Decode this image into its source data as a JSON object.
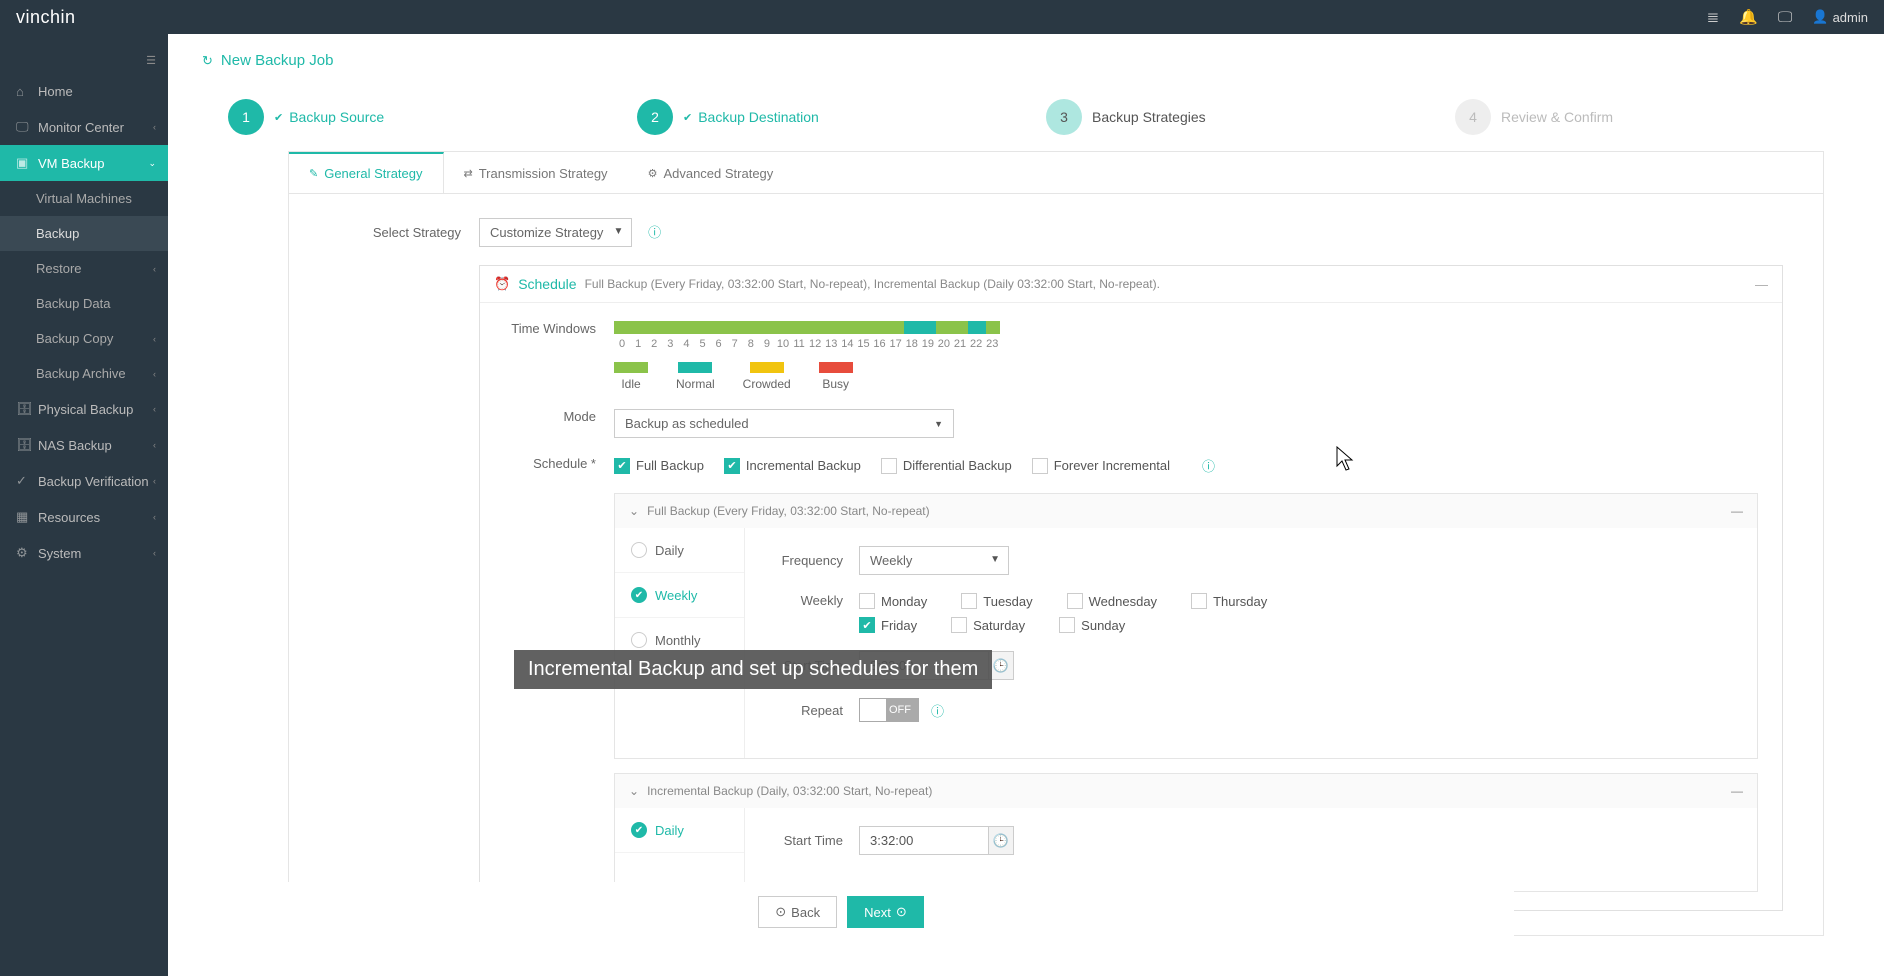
{
  "header": {
    "brand_prefix": "vin",
    "brand_suffix": "chin",
    "user_label": "admin"
  },
  "sidebar": {
    "items": [
      "Home",
      "Monitor Center",
      "VM Backup",
      "Virtual Machines",
      "Backup",
      "Restore",
      "Backup Data",
      "Backup Copy",
      "Backup Archive",
      "Physical Backup",
      "NAS Backup",
      "Backup Verification",
      "Resources",
      "System"
    ]
  },
  "page": {
    "title": "New Backup Job"
  },
  "stepper": {
    "s1": "Backup Source",
    "s2": "Backup Destination",
    "s3": "Backup Strategies",
    "s4": "Review & Confirm",
    "n1": "1",
    "n2": "2",
    "n3": "3",
    "n4": "4"
  },
  "tabs": {
    "general": "General Strategy",
    "transmission": "Transmission Strategy",
    "advanced": "Advanced Strategy"
  },
  "form": {
    "select_strategy_label": "Select Strategy",
    "select_strategy_value": "Customize Strategy",
    "schedule_title": "Schedule",
    "schedule_desc": "Full Backup (Every Friday, 03:32:00 Start, No-repeat), Incremental Backup (Daily 03:32:00 Start, No-repeat).",
    "time_windows_label": "Time Windows",
    "hours": [
      "0",
      "1",
      "2",
      "3",
      "4",
      "5",
      "6",
      "7",
      "8",
      "9",
      "10",
      "11",
      "12",
      "13",
      "14",
      "15",
      "16",
      "17",
      "18",
      "19",
      "20",
      "21",
      "22",
      "23"
    ],
    "legend": {
      "idle": "Idle",
      "normal": "Normal",
      "crowded": "Crowded",
      "busy": "Busy"
    },
    "colors": {
      "idle": "#8bc34a",
      "normal": "#1fb9a8",
      "crowded": "#f1c40f",
      "busy": "#e74c3c"
    },
    "mode_label": "Mode",
    "mode_value": "Backup as scheduled",
    "schedule_label": "Schedule *",
    "types": {
      "full": "Full Backup",
      "incremental": "Incremental Backup",
      "differential": "Differential Backup",
      "forever": "Forever Incremental"
    },
    "full_section": "Full Backup (Every Friday, 03:32:00 Start, No-repeat)",
    "freq": {
      "daily": "Daily",
      "weekly": "Weekly",
      "monthly": "Monthly"
    },
    "frequency_label": "Frequency",
    "frequency_value": "Weekly",
    "weekly_label": "Weekly",
    "days": {
      "mon": "Monday",
      "tue": "Tuesday",
      "wed": "Wednesday",
      "thu": "Thursday",
      "fri": "Friday",
      "sat": "Saturday",
      "sun": "Sunday"
    },
    "start_time_label": "Start Time",
    "start_time_value": "3:32:00",
    "repeat_label": "Repeat",
    "repeat_state": "OFF",
    "inc_section": "Incremental Backup (Daily, 03:32:00 Start, No-repeat)",
    "inc_start_time_value": "3:32:00"
  },
  "footer": {
    "back": "Back",
    "next": "Next"
  },
  "caption": "Incremental Backup and set up schedules for them"
}
